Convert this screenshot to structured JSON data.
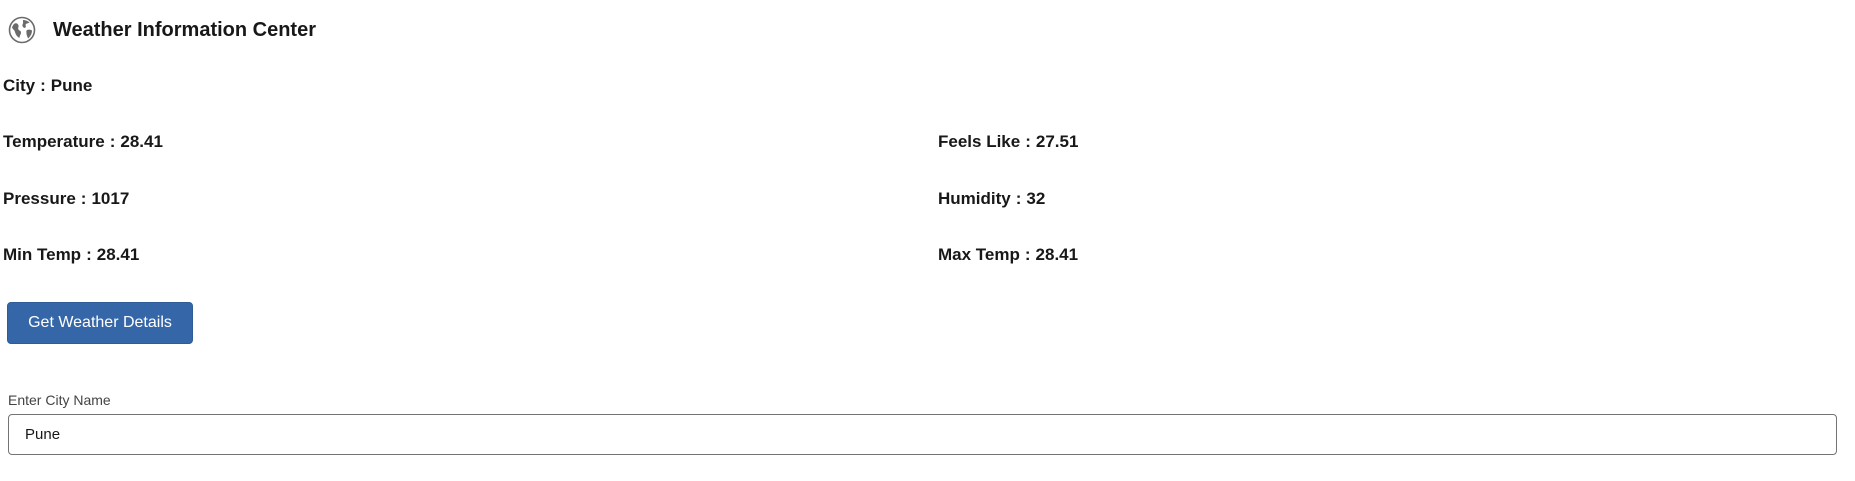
{
  "header": {
    "title": "Weather Information Center",
    "icon": "globe-icon"
  },
  "fields": {
    "city": {
      "label": "City",
      "value": "Pune"
    },
    "temperature": {
      "label": "Temperature",
      "value": "28.41"
    },
    "feels_like": {
      "label": "Feels Like",
      "value": "27.51"
    },
    "pressure": {
      "label": "Pressure",
      "value": "1017"
    },
    "humidity": {
      "label": "Humidity",
      "value": "32"
    },
    "min_temp": {
      "label": "Min Temp",
      "value": "28.41"
    },
    "max_temp": {
      "label": "Max Temp",
      "value": "28.41"
    },
    "separator": ":"
  },
  "actions": {
    "get_details_label": "Get Weather Details"
  },
  "city_input": {
    "label": "Enter City Name",
    "value": "Pune"
  },
  "colors": {
    "button_bg": "#3567a8",
    "text": "#181818"
  }
}
